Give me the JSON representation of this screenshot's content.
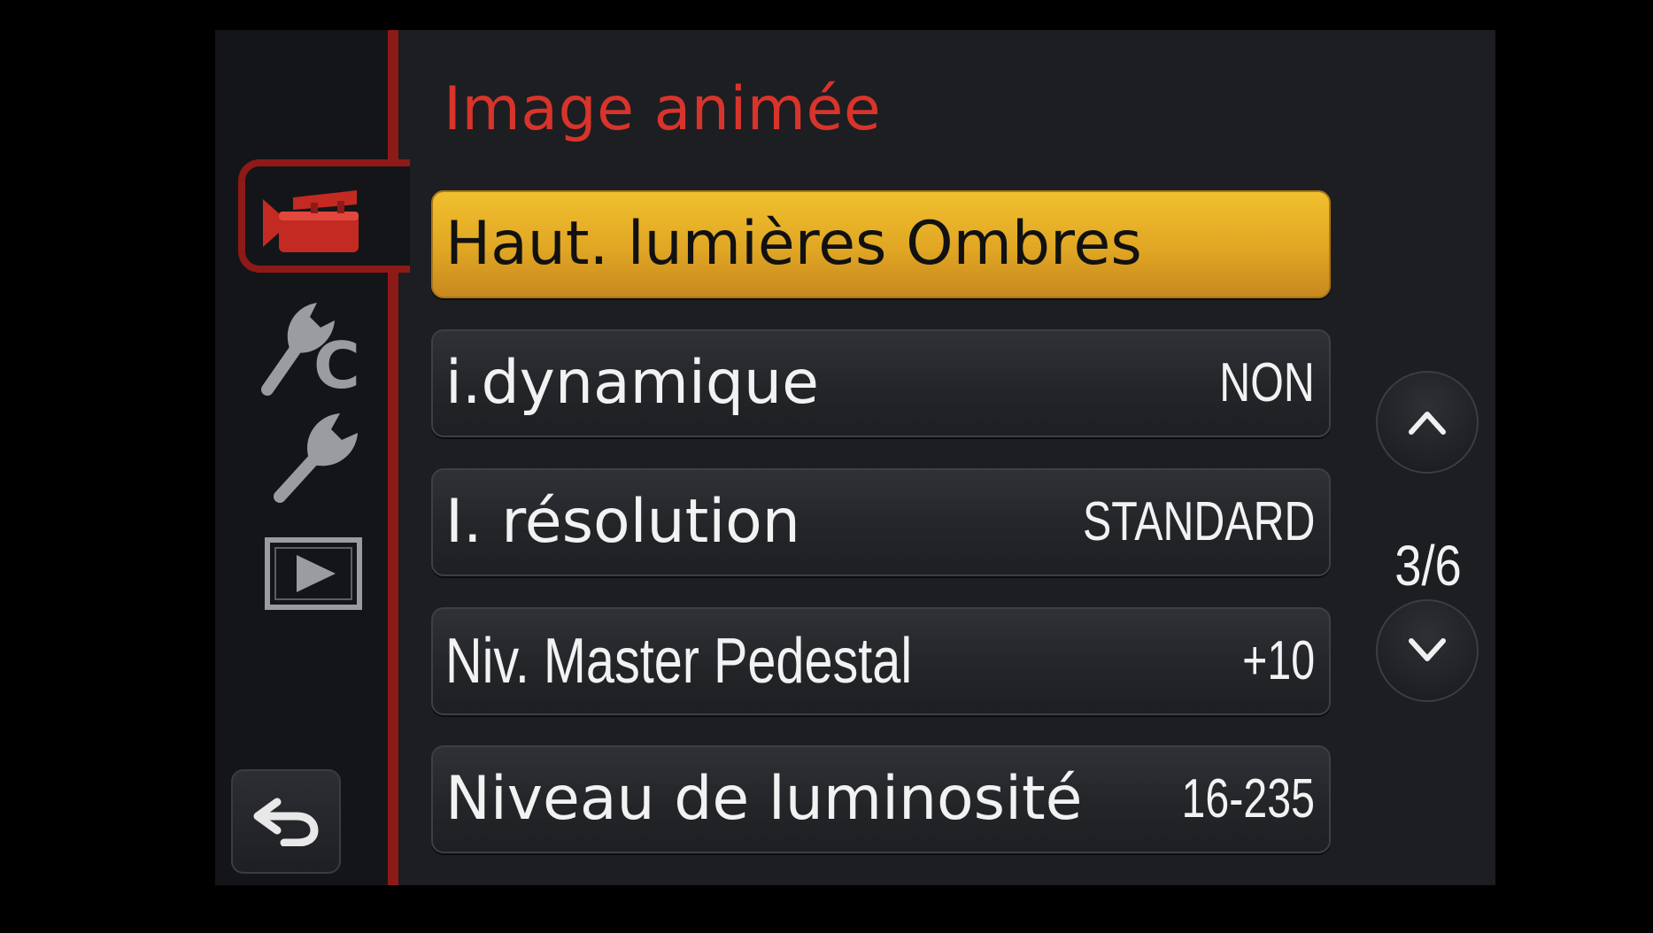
{
  "menu": {
    "title": "Image animée",
    "items": [
      {
        "label": "Haut. lumières Ombres",
        "value": "",
        "selected": true
      },
      {
        "label": "i.dynamique",
        "value": "NON",
        "selected": false
      },
      {
        "label": "I. résolution",
        "value": "STANDARD",
        "selected": false
      },
      {
        "label": "Niv. Master Pedestal",
        "value": "+10",
        "selected": false
      },
      {
        "label": "Niveau de luminosité",
        "value": "16-235",
        "selected": false
      }
    ]
  },
  "pagination": {
    "page": "3/6"
  },
  "sidebar": {
    "tabs": [
      {
        "icon": "movie-camera-icon",
        "active": true
      },
      {
        "icon": "custom-wrench-icon",
        "active": false
      },
      {
        "icon": "wrench-icon",
        "active": false
      },
      {
        "icon": "playback-icon",
        "active": false
      }
    ],
    "back_icon": "return-arrow-icon"
  },
  "colors": {
    "accent_red": "#d8342b",
    "rail_red": "#8e1a17",
    "selected_yellow": "#e0a624",
    "background": "#1c1e22"
  }
}
